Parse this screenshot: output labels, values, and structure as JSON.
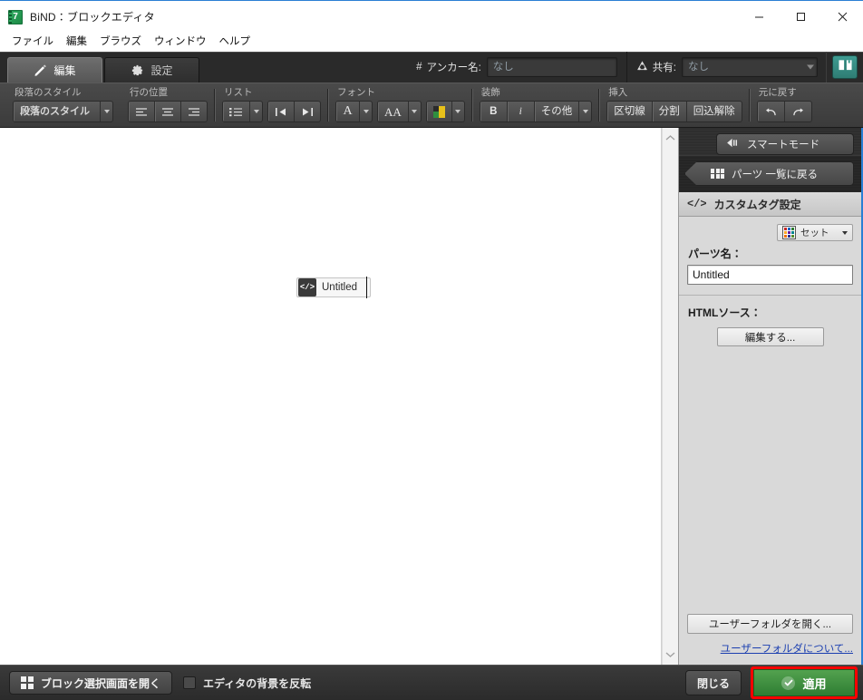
{
  "window": {
    "title": "BiND：ブロックエディタ",
    "app_icon": "bind-app-icon",
    "minimize_label": "−",
    "maximize_label": "□",
    "close_label": "✕"
  },
  "menubar": {
    "items": [
      {
        "label": "ファイル",
        "name": "menu-file"
      },
      {
        "label": "編集",
        "name": "menu-edit"
      },
      {
        "label": "ブラウズ",
        "name": "menu-browse"
      },
      {
        "label": "ウィンドウ",
        "name": "menu-window"
      },
      {
        "label": "ヘルプ",
        "name": "menu-help"
      }
    ]
  },
  "tabs": [
    {
      "label": "編集",
      "icon": "pencil-icon",
      "active": true
    },
    {
      "label": "設定",
      "icon": "gear-icon",
      "active": false
    }
  ],
  "topbar": {
    "anchor": {
      "icon": "hash-icon",
      "label": "アンカー名:",
      "value": "",
      "placeholder": "なし"
    },
    "share": {
      "icon": "share-triangle-icon",
      "label": "共有:",
      "value": "",
      "placeholder": "なし"
    },
    "manual_button": {
      "icon": "book-icon",
      "label": ""
    }
  },
  "toolbar": {
    "groups": [
      {
        "title": "段落のスタイル",
        "name": "paragraph-style-group",
        "buttons": [
          {
            "label": "段落のスタイル",
            "name": "paragraph-style-select"
          }
        ]
      },
      {
        "title": "行の位置",
        "name": "line-align-group",
        "buttons": [
          {
            "label": "",
            "name": "align-left-button"
          },
          {
            "label": "",
            "name": "align-center-button"
          },
          {
            "label": "",
            "name": "align-right-button"
          }
        ]
      },
      {
        "title": "リスト",
        "name": "list-group",
        "buttons": [
          {
            "label": "",
            "name": "bullet-list-button"
          },
          {
            "label": "",
            "name": "outdent-button"
          },
          {
            "label": "",
            "name": "indent-button"
          }
        ]
      },
      {
        "title": "フォント",
        "name": "font-group",
        "buttons": [
          {
            "label": "A",
            "name": "font-family-button"
          },
          {
            "label": "AA",
            "name": "font-size-button"
          },
          {
            "label": "",
            "name": "font-color-button"
          }
        ]
      },
      {
        "title": "装飾",
        "name": "decoration-group",
        "buttons": [
          {
            "label": "B",
            "name": "bold-button"
          },
          {
            "label": "i",
            "name": "italic-button"
          },
          {
            "label": "その他",
            "name": "other-decoration-button"
          }
        ]
      },
      {
        "title": "挿入",
        "name": "insert-group",
        "buttons": [
          {
            "label": "区切線",
            "name": "insert-divider-button"
          },
          {
            "label": "分割",
            "name": "insert-split-button"
          },
          {
            "label": "回込解除",
            "name": "clear-float-button"
          }
        ]
      },
      {
        "title": "元に戻す",
        "name": "undo-group",
        "buttons": [
          {
            "label": "",
            "name": "undo-button"
          },
          {
            "label": "",
            "name": "redo-button"
          }
        ]
      }
    ]
  },
  "canvas": {
    "block": {
      "icon": "code-tag-icon",
      "icon_glyph": "</>",
      "label": "Untitled"
    }
  },
  "right_panel": {
    "smart_mode": {
      "label": "スマートモード",
      "icon": "arrow-left-collapse-icon"
    },
    "back_to_parts": {
      "label": "パーツ 一覧に戻る",
      "icon": "grid-icon"
    },
    "header": {
      "label": "カスタムタグ設定",
      "icon": "code-tag-icon",
      "icon_glyph": "</>"
    },
    "set_button": {
      "label": "セット",
      "icon": "color-grid-icon"
    },
    "parts_name": {
      "label": "パーツ名：",
      "value": "Untitled",
      "placeholder": ""
    },
    "html_source": {
      "label": "HTMLソース：",
      "edit_button": "編集する..."
    },
    "user_folder_button": "ユーザーフォルダを開く...",
    "user_folder_link": "ユーザーフォルダについて..."
  },
  "bottom_bar": {
    "block_select_button": {
      "label": "ブロック選択画面を開く",
      "icon": "grid-icon"
    },
    "invert_bg_checkbox": {
      "label": "エディタの背景を反転",
      "checked": false
    },
    "close_button": "閉じる",
    "apply_button": {
      "label": "適用",
      "icon": "check-circle-icon",
      "highlighted": true
    }
  },
  "colors": {
    "accent_blue": "#2a7fd4",
    "apply_green": "#3e8e41",
    "highlight_red": "#ff0000",
    "toolbar_dark": "#3b3b3b",
    "panel_gray": "#d9d9d9",
    "link_blue": "#1b3fb0"
  }
}
